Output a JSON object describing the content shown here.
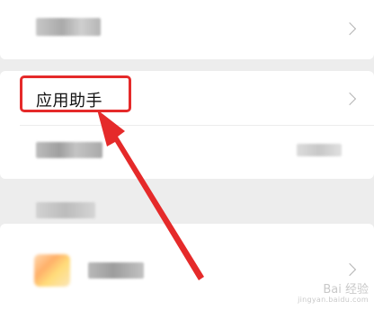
{
  "screen": {
    "app_helper_label": "应用助手"
  },
  "colors": {
    "annotation_red": "#e52a2a",
    "card_bg": "#ffffff",
    "page_bg": "#ededed"
  },
  "watermark": {
    "brand": "Bai 经验",
    "url": "jingyan.baidu.com"
  }
}
